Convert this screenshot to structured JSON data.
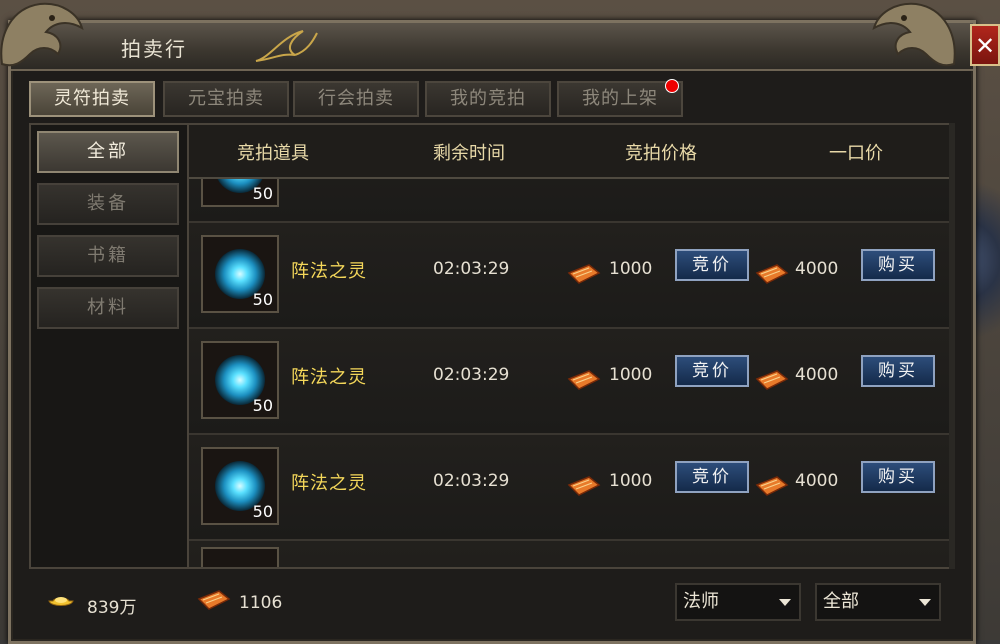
{
  "window": {
    "title": "拍卖行"
  },
  "tabs": [
    {
      "label": "灵符拍卖",
      "active": true
    },
    {
      "label": "元宝拍卖",
      "active": false
    },
    {
      "label": "行会拍卖",
      "active": false
    },
    {
      "label": "我的竞拍",
      "active": false
    },
    {
      "label": "我的上架",
      "active": false,
      "notification": true
    }
  ],
  "categories": [
    {
      "label": "全部",
      "active": true
    },
    {
      "label": "装备",
      "active": false
    },
    {
      "label": "书籍",
      "active": false
    },
    {
      "label": "材料",
      "active": false
    }
  ],
  "columns": {
    "item": "竞拍道具",
    "time": "剩余时间",
    "bid_price": "竞拍价格",
    "buyout": "一口价"
  },
  "rows": [
    {
      "qty": "50",
      "name": "阵法之灵",
      "time": "02:03:29",
      "bid": "1000",
      "bid_button": "竞价",
      "buyout": "4000",
      "buy_button": "购买"
    },
    {
      "qty": "50",
      "name": "阵法之灵",
      "time": "02:03:29",
      "bid": "1000",
      "bid_button": "竞价",
      "buyout": "4000",
      "buy_button": "购买"
    },
    {
      "qty": "50",
      "name": "阵法之灵",
      "time": "02:03:29",
      "bid": "1000",
      "bid_button": "竞价",
      "buyout": "4000",
      "buy_button": "购买"
    }
  ],
  "partial_row": {
    "qty": "50"
  },
  "footer": {
    "gold": "839万",
    "tickets": "1106",
    "class_select": "法师",
    "filter_select": "全部"
  },
  "colors": {
    "accent_gold": "#f4d75a",
    "header_text": "#e8d9a8",
    "button_blue": "#2d4d7a",
    "close_red": "#b1261c",
    "notify_red": "#e00000"
  },
  "icons": [
    "dragon-ornament",
    "ticket-icon",
    "gold-ingot-icon",
    "spirit-orb-icon",
    "close-icon",
    "dropdown-arrow-icon"
  ]
}
